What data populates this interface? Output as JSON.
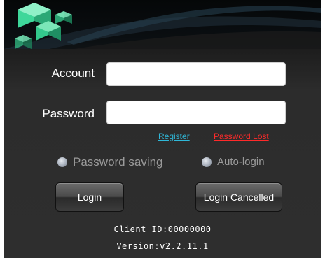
{
  "form": {
    "account_label": "Account",
    "account_value": "",
    "password_label": "Password",
    "password_value": ""
  },
  "links": {
    "register": "Register",
    "password_lost": "Password Lost"
  },
  "options": {
    "password_saving": "Password saving",
    "auto_login": "Auto-login"
  },
  "buttons": {
    "login": "Login",
    "login_cancelled": "Login Cancelled"
  },
  "footer": {
    "client_id": "Client ID:00000000",
    "version": "Version:v2.2.11.1"
  },
  "colors": {
    "register_link": "#2fb8d8",
    "password_lost_link": "#ff2a2a",
    "logo_green": "#3fd8a0"
  }
}
